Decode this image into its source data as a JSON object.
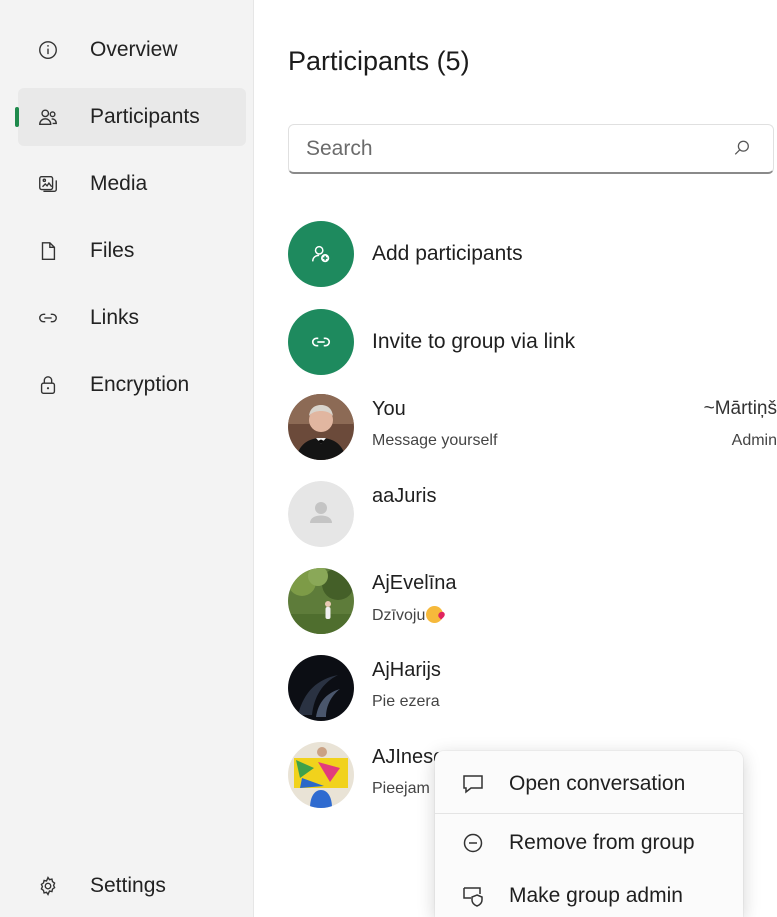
{
  "sidebar": {
    "items": [
      {
        "label": "Overview",
        "icon": "info-icon"
      },
      {
        "label": "Participants",
        "icon": "people-icon"
      },
      {
        "label": "Media",
        "icon": "media-icon"
      },
      {
        "label": "Files",
        "icon": "file-icon"
      },
      {
        "label": "Links",
        "icon": "link-icon"
      },
      {
        "label": "Encryption",
        "icon": "lock-icon"
      }
    ],
    "active_index": 1,
    "settings_label": "Settings",
    "accent_color": "#1f8a4c"
  },
  "main": {
    "title": "Participants (5)",
    "search": {
      "placeholder": "Search",
      "value": ""
    },
    "actions": [
      {
        "label": "Add participants",
        "icon": "add-person-icon"
      },
      {
        "label": "Invite to group via link",
        "icon": "link-icon"
      }
    ],
    "action_color": "#1e8a5e",
    "participants": [
      {
        "name": "You",
        "status": "Message yourself",
        "display_name": "~Mārtiņš",
        "role": "Admin"
      },
      {
        "name": "aaJuris",
        "status": ""
      },
      {
        "name": "AjEvelīna",
        "status": "Dzīvoju"
      },
      {
        "name": "AjHarijs",
        "status": "Pie ezera"
      },
      {
        "name": "AJInese",
        "status": "Pieejam"
      }
    ]
  },
  "context_menu": {
    "items": [
      {
        "label": "Open conversation",
        "icon": "chat-icon"
      },
      {
        "label": "Remove from group",
        "icon": "minus-circle-icon"
      },
      {
        "label": "Make group admin",
        "icon": "admin-shield-icon"
      }
    ]
  }
}
